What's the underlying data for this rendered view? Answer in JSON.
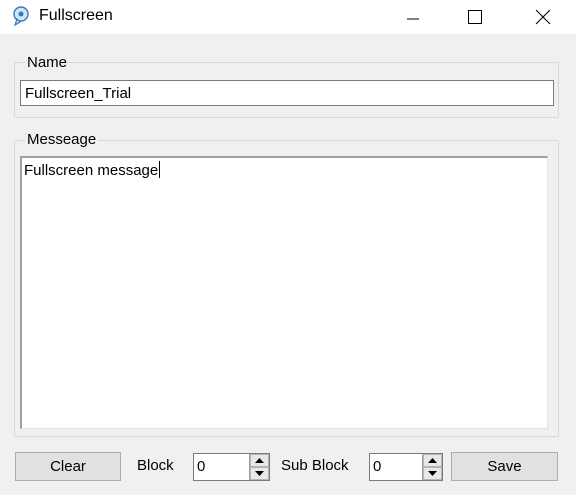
{
  "window": {
    "title": "Fullscreen",
    "icon": "app-icon",
    "controls": [
      "minimize-icon",
      "maximize-icon",
      "close-icon"
    ]
  },
  "name_group": {
    "label": "Name",
    "value": "Fullscreen_Trial"
  },
  "message_group": {
    "label": "Messeage",
    "value": "Fullscreen message"
  },
  "footer": {
    "clear_label": "Clear",
    "block_label": "Block",
    "block_value": "0",
    "sub_block_label": "Sub Block",
    "sub_block_value": "0",
    "save_label": "Save"
  }
}
